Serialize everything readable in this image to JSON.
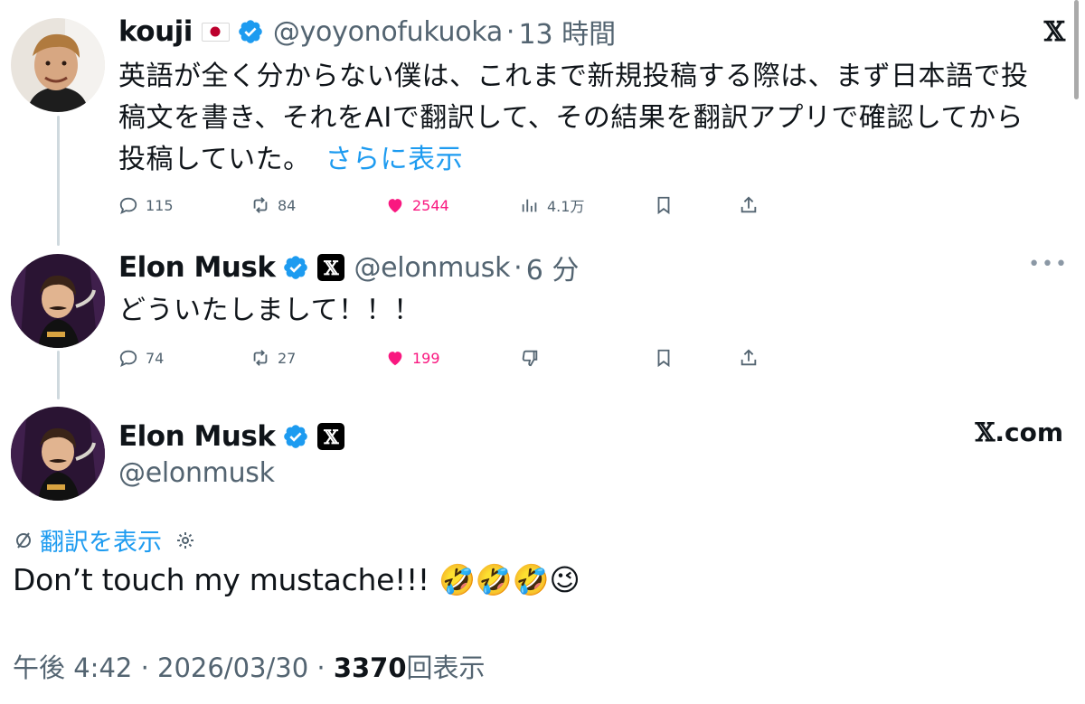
{
  "tweet1": {
    "name": "kouji",
    "handle": "@yoyonofukuoka",
    "sep": "·",
    "time": "13 時間",
    "text_lines": [
      "英語が全く分からない僕は、これまで新規投稿する際は、まず日本語で投",
      "稿文を書き、それをAIで翻訳して、その結果を翻訳アプリで確認してから",
      "投稿していた。"
    ],
    "show_more": "さらに表示",
    "replies": "115",
    "retweets": "84",
    "likes": "2544",
    "views": "4.1万"
  },
  "tweet2": {
    "name": "Elon Musk",
    "x_badge": "𝕏",
    "handle": "@elonmusk",
    "sep": "·",
    "time": "6 分",
    "text": "どういたしまして！！！",
    "replies": "74",
    "retweets": "27",
    "likes": "199"
  },
  "embed": {
    "name": "Elon Musk",
    "x_badge": "𝕏",
    "handle": "@elonmusk",
    "site_glyph": "𝕏",
    "site_text": ".com",
    "translate_label": "翻訳を表示",
    "text": "Don’t touch my mustache!!! 🤣🤣🤣😉",
    "time": "午後 4:42",
    "date": "2026/03/30",
    "sep": "·",
    "views": "3370",
    "views_label": "回表示"
  },
  "top_x": "𝕏",
  "colors": {
    "accent": "#1d9bf0",
    "like": "#f91880",
    "muted": "#536471"
  }
}
